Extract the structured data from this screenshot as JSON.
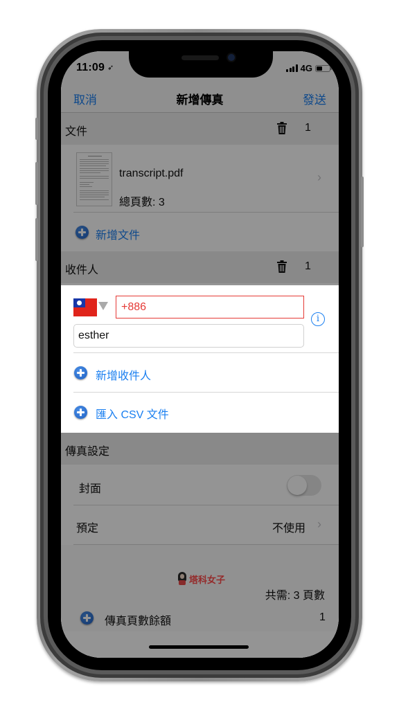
{
  "status_bar": {
    "time": "11:09",
    "network": "4G"
  },
  "nav": {
    "cancel_label": "取消",
    "title": "新增傳真",
    "send_label": "發送"
  },
  "documents": {
    "header": "文件",
    "count": "1",
    "files": [
      {
        "name": "transcript.pdf",
        "pages_text": "總頁數: 3"
      }
    ],
    "add_label": "新增文件"
  },
  "recipients": {
    "header": "收件人",
    "count": "1",
    "phone_value": "+886",
    "name_value": "esther",
    "add_label": "新增收件人",
    "import_label": "匯入 CSV 文件"
  },
  "fax_settings": {
    "header": "傳真設定",
    "cover_label": "封面",
    "cover_enabled": false,
    "schedule_label": "預定",
    "schedule_value": "不使用"
  },
  "footer": {
    "watermark": "塔科女子",
    "total_text": "共需: 3 頁數",
    "credit_label": "傳真頁數餘額",
    "credit_value": "1"
  },
  "colors": {
    "accent": "#1a7ff0",
    "error": "#e53935"
  }
}
